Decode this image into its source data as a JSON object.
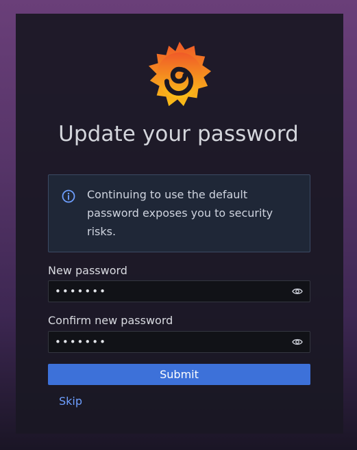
{
  "page": {
    "title": "Update your password"
  },
  "alert": {
    "icon": "info-circle-icon",
    "message": "Continuing to use the default password exposes you to security risks."
  },
  "form": {
    "new_password": {
      "label": "New password",
      "value": "•••••••"
    },
    "confirm_password": {
      "label": "Confirm new password",
      "value": "•••••••"
    },
    "visibility_icon": "eye-icon",
    "submit_label": "Submit",
    "skip_label": "Skip"
  },
  "colors": {
    "primary": "#3d71d9",
    "link": "#6e9fff",
    "logo_start": "#f9be18",
    "logo_end": "#f05a28",
    "info": "#6e9fff"
  }
}
